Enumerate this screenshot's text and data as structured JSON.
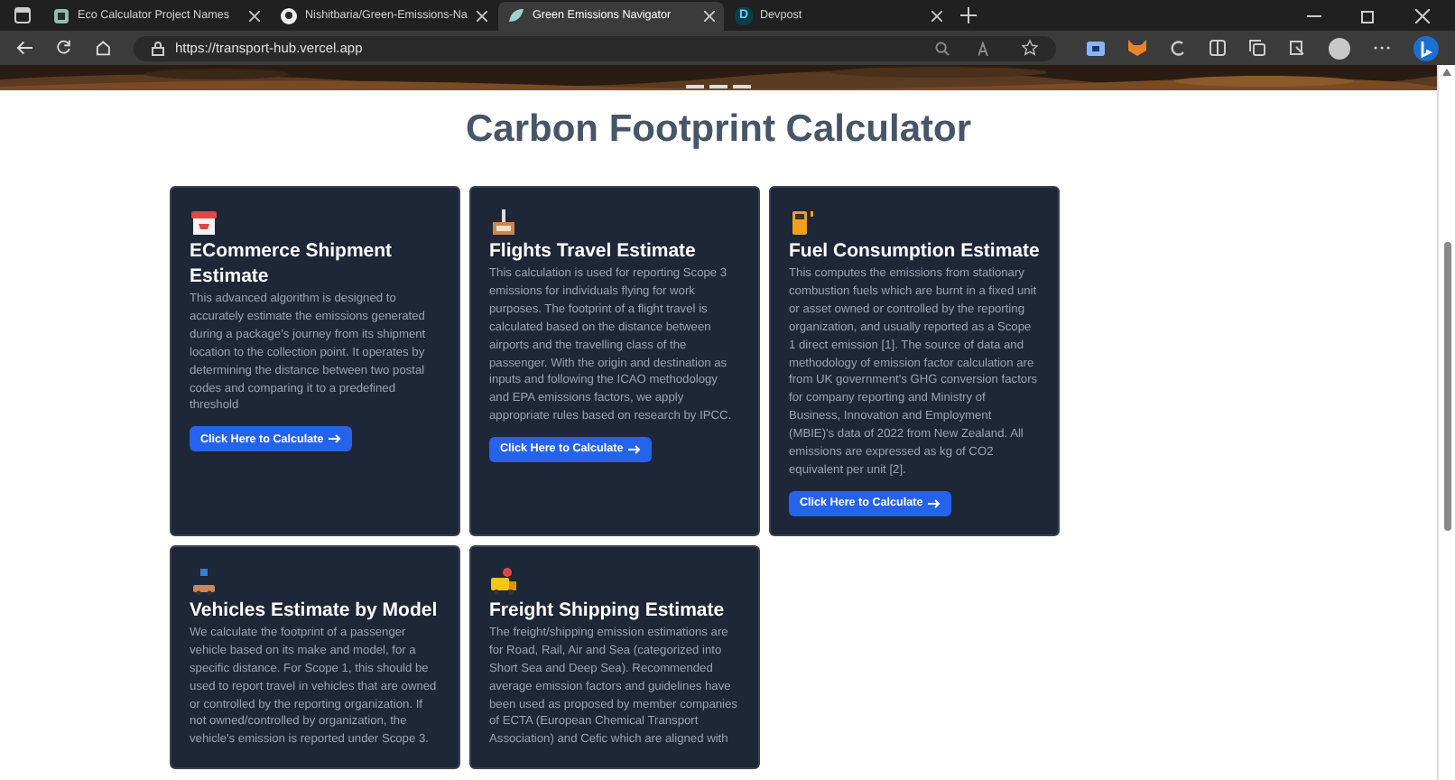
{
  "browser": {
    "tabs": [
      {
        "label": "Eco Calculator Project Names",
        "selected": false
      },
      {
        "label": "Nishitbaria/Green-Emissions-Na",
        "selected": false
      },
      {
        "label": "Green Emissions Navigator",
        "selected": true
      },
      {
        "label": "Devpost",
        "icon_letter": "D",
        "selected": false
      }
    ],
    "url": "https://transport-hub.vercel.app"
  },
  "page": {
    "title": "Carbon Footprint Calculator",
    "cards": [
      {
        "title": "ECommerce Shipment Estimate",
        "description": "This advanced algorithm is designed to accurately estimate the emissions generated during a package's journey from its shipment location to the collection point. It operates by determining the distance between two postal codes and comparing it to a predefined threshold",
        "button": "Click Here to Calculate"
      },
      {
        "title": "Flights Travel Estimate",
        "description": "This calculation is used for reporting Scope 3 emissions for individuals flying for work purposes. The footprint of a flight travel is calculated based on the distance between airports and the travelling class of the passenger. With the origin and destination as inputs and following the ICAO methodology and EPA emissions factors, we apply appropriate rules based on research by IPCC.",
        "button": "Click Here to Calculate"
      },
      {
        "title": "Fuel Consumption Estimate",
        "description": "This computes the emissions from stationary combustion fuels which are burnt in a fixed unit or asset owned or controlled by the reporting organization, and usually reported as a Scope 1 direct emission [1]. The source of data and methodology of emission factor calculation are from UK government's GHG conversion factors for company reporting and Ministry of Business, Innovation and Employment (MBIE)'s data of 2022 from New Zealand. All emissions are expressed as kg of CO2 equivalent per unit [2].",
        "button": "Click Here to Calculate"
      },
      {
        "title": "Vehicles Estimate by Model",
        "description": "We calculate the footprint of a passenger vehicle based on its make and model, for a specific distance. For Scope 1, this should be used to report travel in vehicles that are owned or controlled by the reporting organization. If not owned/controlled by organization, the vehicle's emission is reported under Scope 3."
      },
      {
        "title": "Freight Shipping Estimate",
        "description": "The freight/shipping emission estimations are for Road, Rail, Air and Sea (categorized into Short Sea and Deep Sea). Recommended average emission factors and guidelines have been used as proposed by member companies of ECTA (European Chemical Transport Association) and Cefic which are aligned with"
      }
    ]
  }
}
